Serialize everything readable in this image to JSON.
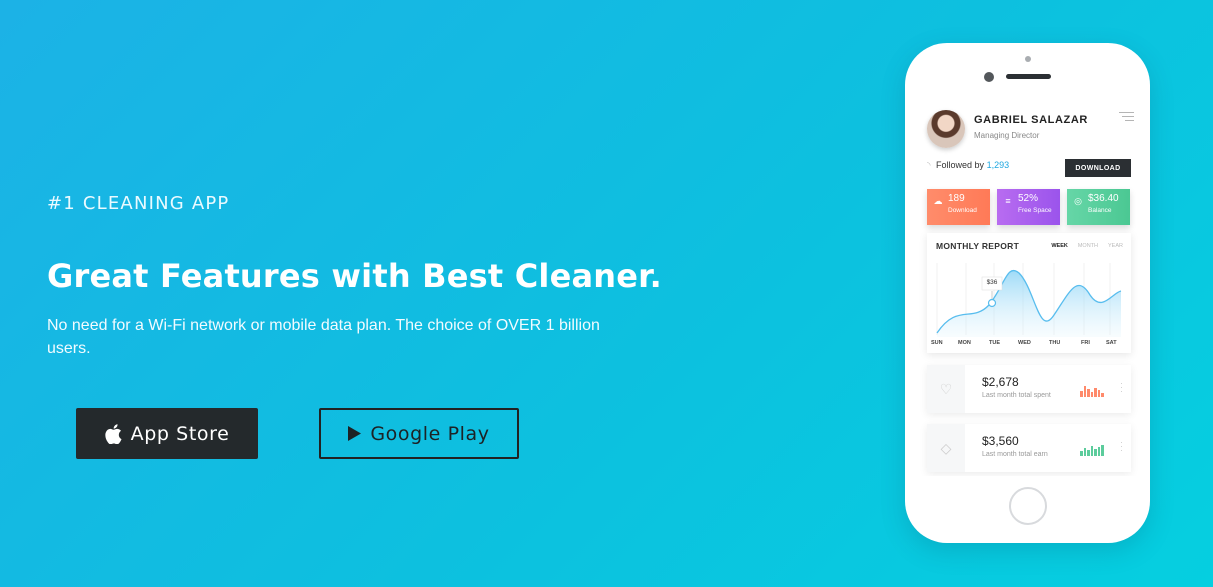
{
  "hero": {
    "eyebrow": "#1 CLEANING APP",
    "headline": "Great Features with Best Cleaner.",
    "description": "No need for a Wi-Fi network or mobile data plan. The choice of OVER 1 billion users.",
    "buttons": {
      "app_store": "App Store",
      "google_play": "Google Play"
    }
  },
  "phone": {
    "profile": {
      "name": "GABRIEL SALAZAR",
      "role": "Managing Director"
    },
    "followed_label": "Followed by",
    "followed_count": "1,293",
    "download_button": "DOWNLOAD",
    "stats": [
      {
        "value": "189",
        "label": "Download",
        "color": "#ff7f5f",
        "icon": "cloud-download-icon"
      },
      {
        "value": "52%",
        "label": "Free Space",
        "color": "#a35cee",
        "icon": "database-icon"
      },
      {
        "value": "$36.40",
        "label": "Balance",
        "color": "#55cc9b",
        "icon": "coin-icon"
      }
    ],
    "report": {
      "title": "MONTHLY REPORT",
      "tabs": [
        "WEEK",
        "MONTH",
        "YEAR"
      ],
      "active_tab": "WEEK",
      "tooltip": "$36",
      "days": [
        "SUN",
        "MON",
        "TUE",
        "WED",
        "THU",
        "FRI",
        "SAT"
      ]
    },
    "cards": [
      {
        "amount": "$2,678",
        "label": "Last month total spent",
        "bar_color": "#ff8a6b",
        "icon": "heart-chat-icon"
      },
      {
        "amount": "$3,560",
        "label": "Last month total earn",
        "bar_color": "#5ccc9c",
        "icon": "diamond-icon"
      }
    ]
  }
}
